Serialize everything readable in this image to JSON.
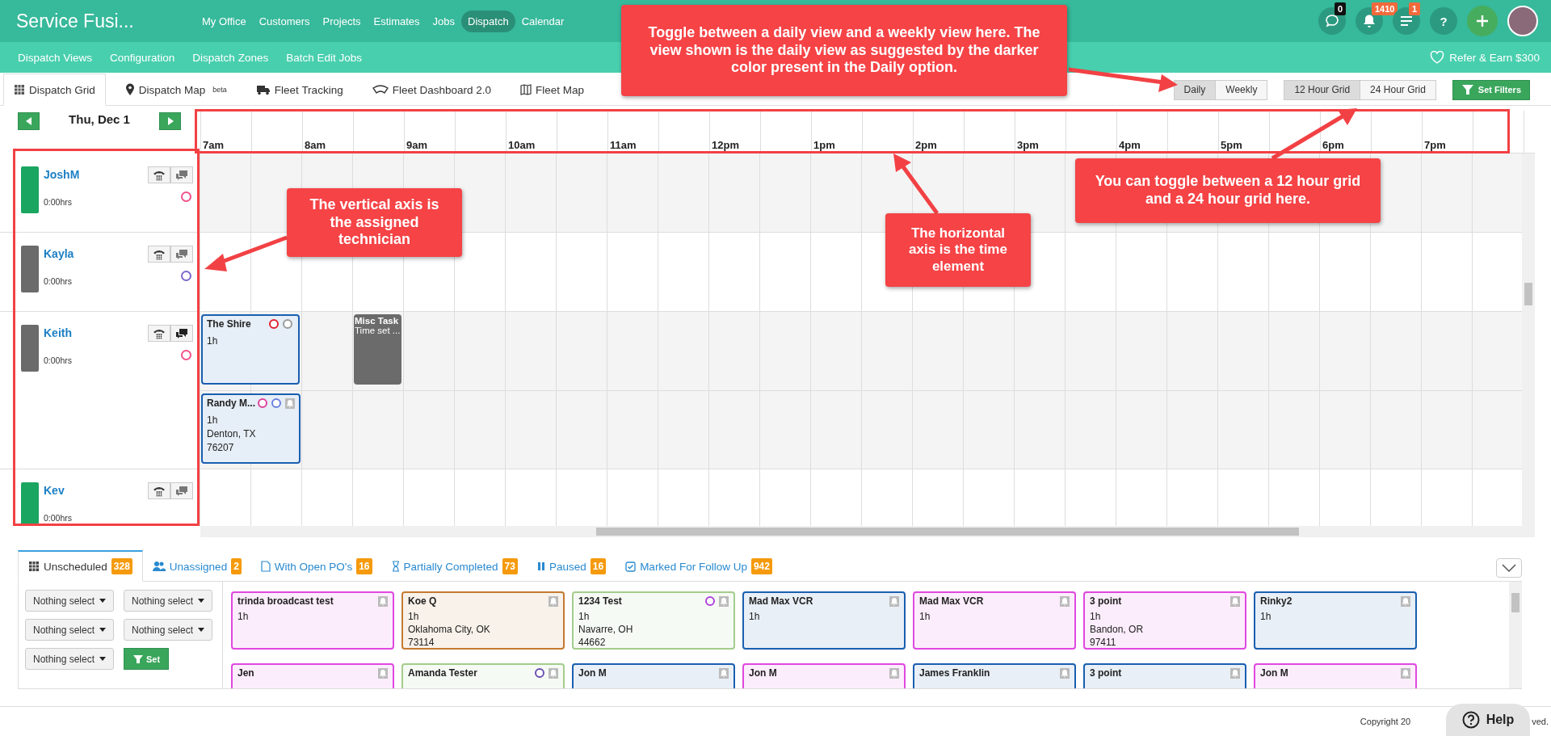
{
  "logo": "Service Fusi...",
  "nav": [
    {
      "label": "My Office",
      "selected": false
    },
    {
      "label": "Customers",
      "selected": false
    },
    {
      "label": "Projects",
      "selected": false
    },
    {
      "label": "Estimates",
      "selected": false
    },
    {
      "label": "Jobs",
      "selected": false
    },
    {
      "label": "Dispatch",
      "selected": true
    },
    {
      "label": "Calendar",
      "selected": false
    }
  ],
  "header_icons": [
    {
      "kind": "chat",
      "badge": "0"
    },
    {
      "kind": "bell",
      "badge": "1410"
    },
    {
      "kind": "list",
      "badge": "1"
    },
    {
      "kind": "help",
      "label": "?"
    },
    {
      "kind": "add"
    },
    {
      "kind": "avatar"
    }
  ],
  "subnav": [
    "Dispatch Views",
    "Configuration",
    "Dispatch Zones",
    "Batch Edit Jobs"
  ],
  "refer": "Refer & Earn $300",
  "view_tabs": [
    {
      "label": "Dispatch Grid",
      "selected": true
    },
    {
      "label": "Dispatch Map",
      "sup": "beta",
      "selected": false
    },
    {
      "label": "Fleet Tracking",
      "selected": false
    },
    {
      "label": "Fleet Dashboard 2.0",
      "selected": false
    },
    {
      "label": "Fleet Map",
      "selected": false
    }
  ],
  "view_toggle": [
    {
      "label": "Daily",
      "selected": true
    },
    {
      "label": "Weekly",
      "selected": false
    }
  ],
  "grid_toggle": [
    {
      "label": "12 Hour Grid",
      "selected": true
    },
    {
      "label": "24 Hour Grid",
      "selected": false
    }
  ],
  "filters_button": "Set Filters",
  "date": "Thu, Dec 1",
  "hours": [
    "7am",
    "8am",
    "9am",
    "10am",
    "11am",
    "12pm",
    "1pm",
    "2pm",
    "3pm",
    "4pm",
    "5pm",
    "6pm",
    "7pm"
  ],
  "technicians": [
    {
      "name": "JoshM",
      "hours": "0:00hrs",
      "online": true,
      "messages": false,
      "dot": {
        "color": "#f0508a"
      }
    },
    {
      "name": "Kayla",
      "hours": "0:00hrs",
      "online": false,
      "messages": false,
      "dot": {
        "color": "#7b68c8"
      }
    },
    {
      "name": "Keith",
      "hours": "0:00hrs",
      "online": false,
      "messages": true,
      "dot": {
        "color": "#f0508a"
      },
      "lanes": [
        {
          "items": [
            {
              "kind": "job",
              "title": "The Shire",
              "duration": "1h",
              "dots": [
                {
                  "color": "#e02030"
                },
                {
                  "color": "#9a9a9a"
                }
              ],
              "bell": false
            },
            {
              "kind": "gap"
            },
            {
              "kind": "task",
              "title": "Misc Task",
              "note": "Time set ..."
            }
          ]
        },
        {
          "items": [
            {
              "kind": "job",
              "title": "Randy M...",
              "duration": "1h",
              "address": [
                "Denton, TX",
                "76207"
              ],
              "dots": [
                {
                  "color": "#e0409a"
                },
                {
                  "color": "#6a7fe0"
                }
              ],
              "bell": true
            }
          ]
        }
      ]
    },
    {
      "name": "Kev",
      "hours": "0:00hrs",
      "online": true,
      "messages": false
    }
  ],
  "bottom_tabs": [
    {
      "label": "Unscheduled",
      "count": "328",
      "selected": true
    },
    {
      "label": "Unassigned",
      "count": "2",
      "selected": false
    },
    {
      "label": "With Open PO's",
      "count": "16",
      "selected": false
    },
    {
      "label": "Partially Completed",
      "count": "73",
      "selected": false
    },
    {
      "label": "Paused",
      "count": "16",
      "selected": false
    },
    {
      "label": "Marked For Follow Up",
      "count": "942",
      "selected": false
    }
  ],
  "filter_dropdowns": [
    "Nothing select",
    "Nothing select",
    "Nothing select",
    "Nothing select",
    "Nothing select"
  ],
  "set_button": "Set",
  "unscheduled_jobs": [
    {
      "title": "trinda broadcast test",
      "duration": "1h",
      "color": "#e048e0"
    },
    {
      "title": "Koe Q",
      "duration": "1h",
      "address": [
        "Oklahoma City, OK",
        "73114"
      ],
      "color": "#c47a30"
    },
    {
      "title": "1234 Test",
      "duration": "1h",
      "address": [
        "Navarre, OH",
        "44662"
      ],
      "color": "#a4cc8c",
      "dot": {
        "color": "#b040e0"
      }
    },
    {
      "title": "Mad Max VCR",
      "duration": "1h",
      "color": "#1a5fb0"
    },
    {
      "title": "Mad Max VCR",
      "duration": "1h",
      "color": "#e048e0"
    },
    {
      "title": "3 point",
      "duration": "1h",
      "address": [
        "Bandon, OR",
        "97411"
      ],
      "color": "#e048e0"
    },
    {
      "title": "Rinky2",
      "duration": "1h",
      "color": "#1a5fb0"
    },
    {
      "title": "Jen",
      "color": "#e048e0"
    },
    {
      "title": "Amanda Tester",
      "color": "#a4cc8c",
      "dot": {
        "color": "#6a4fb0"
      }
    },
    {
      "title": "Jon M",
      "color": "#1a5fb0"
    },
    {
      "title": "Jon M",
      "color": "#e048e0"
    },
    {
      "title": "James Franklin",
      "color": "#1a5fb0"
    },
    {
      "title": "3 point",
      "color": "#1a5fb0"
    },
    {
      "title": "Jon M",
      "color": "#e048e0"
    }
  ],
  "footer": {
    "copyright": "Copyright 20",
    "copyright_end": "ved."
  },
  "help_button": "Help",
  "annotations": [
    {
      "text": "Toggle between a daily view and a weekly view here. The view shown is the daily view as suggested by the darker color present in the Daily option."
    },
    {
      "text": "The vertical axis is the assigned technician"
    },
    {
      "text": "The horizontal axis is the time element"
    },
    {
      "text": "You can toggle between a 12 hour grid and a 24 hour grid here."
    }
  ]
}
